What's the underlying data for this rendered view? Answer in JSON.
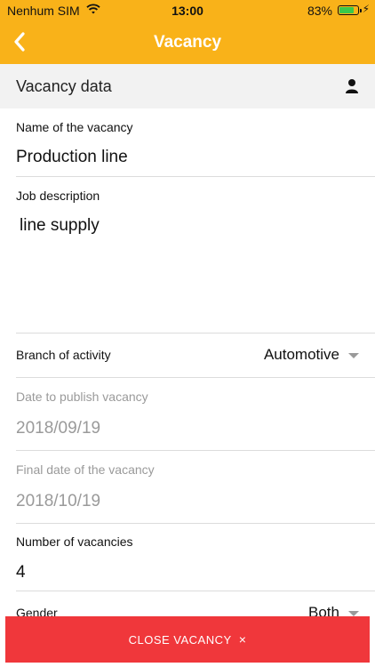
{
  "status_bar": {
    "carrier": "Nenhum SIM",
    "time": "13:00",
    "battery_percent": "83%",
    "battery_level": 0.83
  },
  "header": {
    "title": "Vacancy",
    "back_icon": "chevron-left-icon"
  },
  "section": {
    "title": "Vacancy data",
    "icon": "user-icon"
  },
  "fields": {
    "name": {
      "label": "Name of the vacancy",
      "value": "Production line"
    },
    "description": {
      "label": "Job description",
      "value": "line supply"
    },
    "branch": {
      "label": "Branch of activity",
      "value": "Automotive"
    },
    "publish_date": {
      "label": "Date to publish vacancy",
      "value": "2018/09/19"
    },
    "final_date": {
      "label": "Final date of the vacancy",
      "value": "2018/10/19"
    },
    "count": {
      "label": "Number of vacancies",
      "value": "4"
    },
    "gender": {
      "label": "Gender",
      "value": "Both"
    }
  },
  "actions": {
    "close_label": "CLOSE VACANCY",
    "close_icon": "×"
  },
  "colors": {
    "accent": "#F9B219",
    "danger": "#F0373B",
    "battery": "#3AC94A"
  }
}
